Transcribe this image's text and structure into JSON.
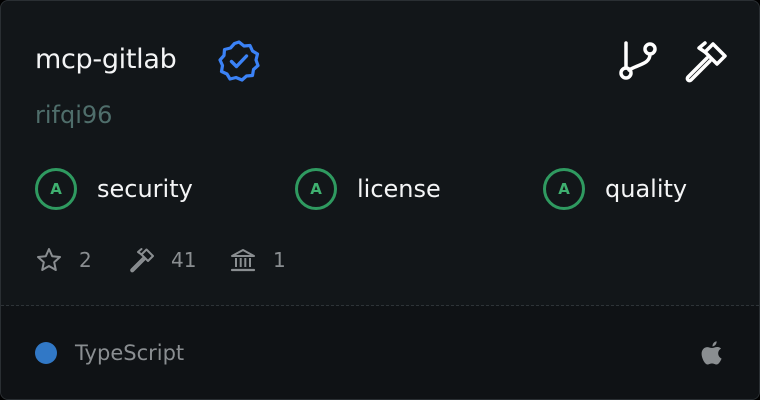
{
  "card": {
    "name": "mcp-gitlab",
    "owner": "rifqi96",
    "verified_icon": "verified-badge-icon",
    "actions": [
      {
        "icon": "git-fork-icon"
      },
      {
        "icon": "hammer-icon"
      }
    ]
  },
  "scores": [
    {
      "grade": "A",
      "label": "security"
    },
    {
      "grade": "A",
      "label": "license"
    },
    {
      "grade": "A",
      "label": "quality"
    }
  ],
  "stats": [
    {
      "icon": "star-icon",
      "value": "2"
    },
    {
      "icon": "hammer-icon",
      "value": "41"
    },
    {
      "icon": "bank-icon",
      "value": "1"
    }
  ],
  "footer": {
    "language": "TypeScript",
    "language_color": "#3178c6",
    "platform_icon": "apple-icon"
  },
  "colors": {
    "background": "#121619",
    "grade_green": "#2f9a60",
    "verified_blue": "#3b82f6",
    "owner_text": "#4f6e6b"
  }
}
